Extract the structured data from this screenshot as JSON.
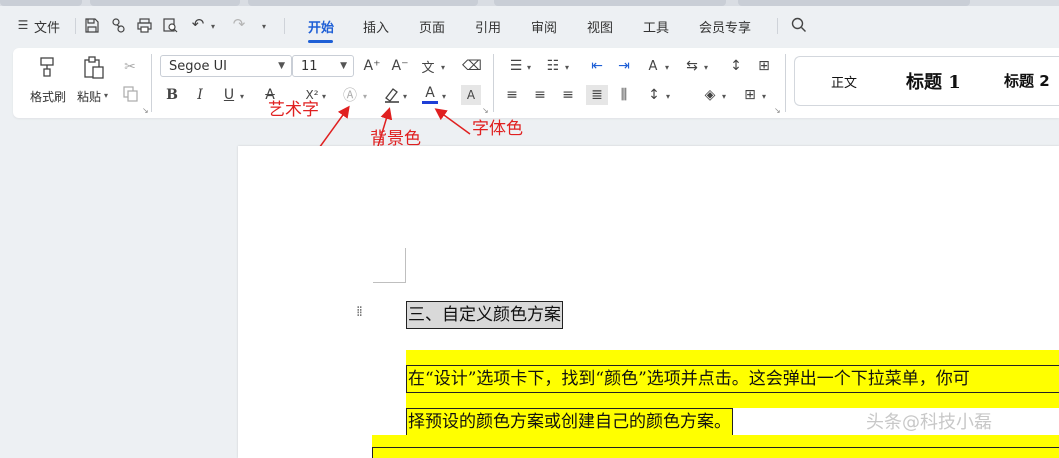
{
  "menubar": {
    "file_label": "文件",
    "tabs": [
      "开始",
      "插入",
      "页面",
      "引用",
      "审阅",
      "视图",
      "工具",
      "会员专享"
    ]
  },
  "ribbon": {
    "format_painter_label": "格式刷",
    "paste_label": "粘贴",
    "font_name": "Segoe UI",
    "font_size": "11",
    "bold": "B",
    "italic": "I",
    "underline": "U",
    "font_color_glyph": "A",
    "font_color_hex": "#1f3fd6",
    "styles": [
      "正文",
      "标题 1",
      "标题 2"
    ]
  },
  "annotations": {
    "art_text": "艺术字",
    "background_color": "背景色",
    "font_color": "字体色",
    "color_hex": "#e02020"
  },
  "document": {
    "heading": "三、自定义颜色方案",
    "line1": "在“设计”选项卡下，找到“颜色”选项并点击。这会弹出一个下拉菜单，你可",
    "line2": "择预设的颜色方案或创建自己的颜色方案。",
    "highlight_hex": "#ffff00"
  },
  "watermark": "头条@科技小磊"
}
